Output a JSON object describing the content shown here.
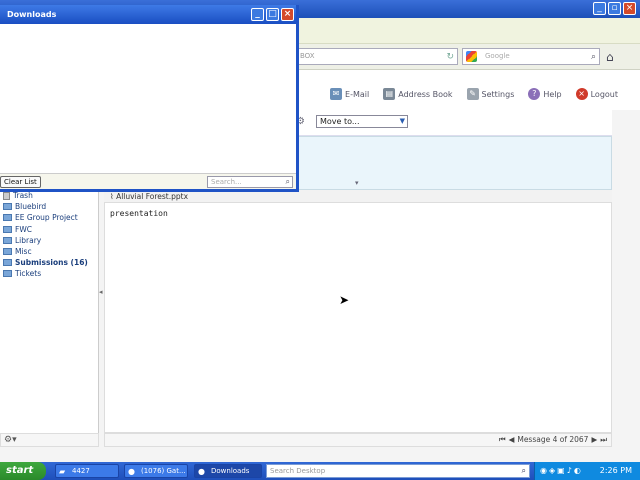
{
  "downloads_window": {
    "title": "Downloads",
    "clear_list_label": "Clear List",
    "search_placeholder": "Search..."
  },
  "browser": {
    "url_fragment": "BOX",
    "search_placeholder": "Google"
  },
  "webmail": {
    "top_nav": [
      {
        "label": "E-Mail",
        "icon": "email-icon"
      },
      {
        "label": "Address Book",
        "icon": "address-book-icon"
      },
      {
        "label": "Settings",
        "icon": "settings-icon"
      },
      {
        "label": "Help",
        "icon": "help-icon"
      },
      {
        "label": "Logout",
        "icon": "logout-icon"
      }
    ],
    "move_to_label": "Move to...",
    "attachment_name": "Alluvial Forest.pptx",
    "message_body": "presentation",
    "folders": [
      {
        "label": "Trash",
        "bold": false
      },
      {
        "label": "Bluebird",
        "bold": false
      },
      {
        "label": "EE Group Project",
        "bold": false
      },
      {
        "label": "FWC",
        "bold": false
      },
      {
        "label": "Library",
        "bold": false
      },
      {
        "label": "Misc",
        "bold": false
      },
      {
        "label": "Submissions (16)",
        "bold": true
      },
      {
        "label": "Tickets",
        "bold": false
      }
    ],
    "message_counter": "Message 4 of 2067"
  },
  "taskbar": {
    "start_label": "start",
    "tasks": [
      {
        "label": "4427",
        "icon": "folder-icon"
      },
      {
        "label": "(1076) Gat...",
        "icon": "firefox-icon"
      },
      {
        "label": "Downloads",
        "icon": "firefox-icon"
      }
    ],
    "desktop_search_placeholder": "Search Desktop",
    "clock": "2:26 PM"
  },
  "colors": {
    "titlebar_blue": "#1a4ec2",
    "taskbar_blue": "#1f4fba",
    "start_green": "#2a8a2a",
    "list_pane_bg": "#eaf5fb"
  }
}
